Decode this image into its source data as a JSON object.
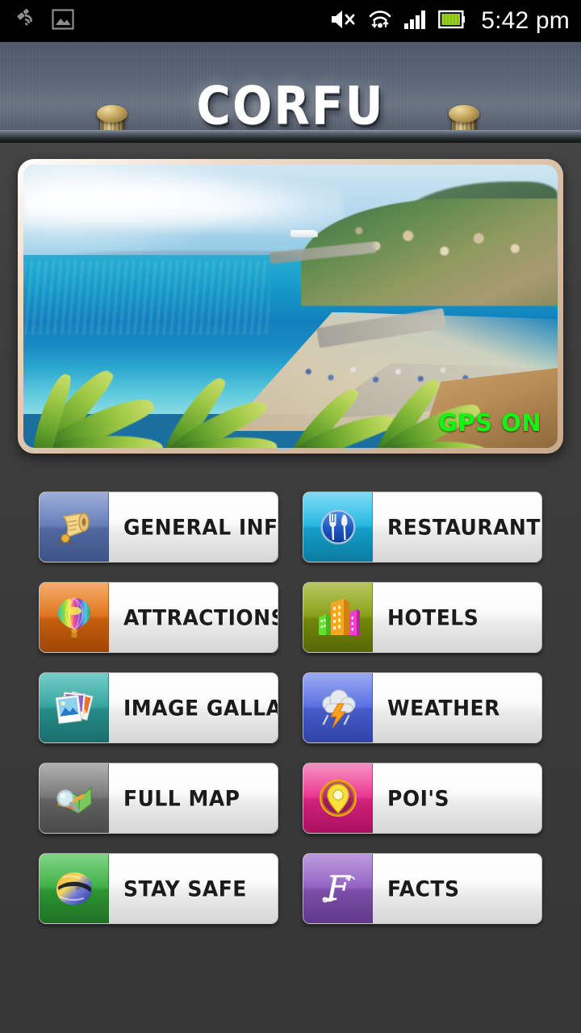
{
  "statusbar": {
    "left_icons": [
      {
        "name": "gps-satellite-icon"
      },
      {
        "name": "screenshot-image-icon"
      }
    ],
    "right_icons": [
      {
        "name": "volume-muted-icon"
      },
      {
        "name": "wifi-icon"
      },
      {
        "name": "cellular-signal-icon"
      },
      {
        "name": "battery-icon"
      }
    ],
    "clock": "5:42 pm"
  },
  "header": {
    "title": "CORFU",
    "lamps": [
      "wall-sconce-left",
      "wall-sconce-right"
    ]
  },
  "hero": {
    "alt": "Corfu coastline with turquoise sea, beach, promenade and palm trees",
    "gps_badge": "GPS ON",
    "gps_color": "#13f513"
  },
  "menu": {
    "items": [
      {
        "label": "GENERAL INFO",
        "icon": "scroll-document-icon",
        "tile_color": "#5b76b5"
      },
      {
        "label": "RESTAURANTS",
        "icon": "fork-knife-icon",
        "tile_color": "#17b2e0"
      },
      {
        "label": "ATTRACTIONS",
        "icon": "hot-air-balloon-icon",
        "tile_color": "#dd6a10"
      },
      {
        "label": "HOTELS",
        "icon": "buildings-icon",
        "tile_color": "#81980d"
      },
      {
        "label": "IMAGE GALLARY",
        "icon": "photo-stack-icon",
        "tile_color": "#2a9e99"
      },
      {
        "label": "WEATHER",
        "icon": "storm-cloud-icon",
        "tile_color": "#4f67e0"
      },
      {
        "label": "FULL MAP",
        "icon": "map-magnifier-icon",
        "tile_color": "#6e6e6e"
      },
      {
        "label": "POI'S",
        "icon": "map-pin-icon",
        "tile_color": "#e8288b"
      },
      {
        "label": "STAY SAFE",
        "icon": "helmet-icon",
        "tile_color": "#33a83a"
      },
      {
        "label": "FACTS",
        "icon": "script-f-icon",
        "tile_color": "#8b59bd"
      }
    ]
  }
}
